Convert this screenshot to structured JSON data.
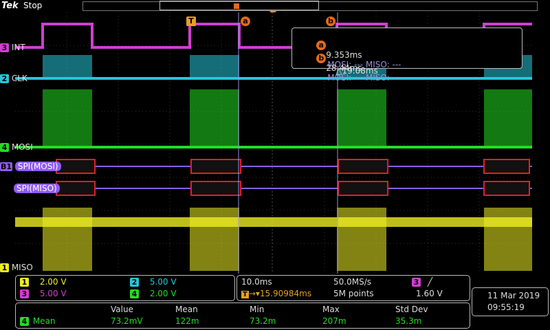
{
  "header": {
    "logo": "Tek",
    "status": "Stop"
  },
  "trigger_marker": "T",
  "cursor_a_label": "a",
  "cursor_b_label": "b",
  "cursor_readout": {
    "a_time": "9.353ms",
    "a_mosi": "MOSI: --- MISO: ---",
    "b_time": "28.44ms",
    "b_mosi": "MOSI: --- MISO: ---",
    "delta": "△19.08ms"
  },
  "channels": {
    "ch3": {
      "num": "3",
      "name": "INT",
      "color": "#d13fd1"
    },
    "ch2": {
      "num": "2",
      "name": "CLK",
      "color": "#26c6da"
    },
    "ch4": {
      "num": "4",
      "name": "MOSI",
      "color": "#22dd22"
    },
    "b1": {
      "num": "B1",
      "name": "SPI(MOSI)",
      "color": "#8f5cf0"
    },
    "b1b": {
      "name": "SPI(MISO)"
    },
    "ch1": {
      "num": "1",
      "name": "MISO",
      "color": "#eeee22"
    }
  },
  "vertical": {
    "ch1": {
      "num": "1",
      "value": "2.00 V"
    },
    "ch2": {
      "num": "2",
      "value": "5.00 V"
    },
    "ch3": {
      "num": "3",
      "value": "5.00 V"
    },
    "ch4": {
      "num": "4",
      "value": "2.00 V"
    }
  },
  "horizontal": {
    "scale": "10.0ms",
    "rate": "50.0MS/s",
    "trigpos": "15.90984ms",
    "points": "5M points"
  },
  "trigger": {
    "source": "3",
    "slope": "╱",
    "level": "1.60 V"
  },
  "datetime": {
    "date": "11 Mar 2019",
    "time": "09:55:19"
  },
  "measure": {
    "headers": [
      "Value",
      "Mean",
      "Min",
      "Max",
      "Std Dev"
    ],
    "source": "4",
    "label": "Mean",
    "values": [
      "73.2mV",
      "122m",
      "73.2m",
      "207m",
      "35.3m"
    ]
  }
}
